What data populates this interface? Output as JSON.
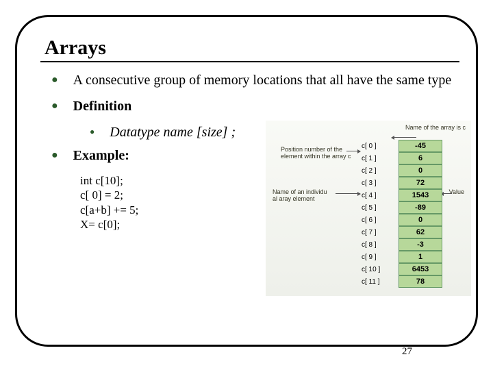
{
  "slide": {
    "title": "Arrays",
    "page_number": "27",
    "bullet_intro": "A consecutive group of memory locations that all have the same type",
    "definition_heading": "Definition",
    "definition_syntax": "Datatype name [size] ;",
    "example_heading": "Example:",
    "example_lines": {
      "l0": "int c[10];",
      "l1": "c[ 0] = 2;",
      "l2": "c[a+b] += 5;",
      "l3": "X= c[0];"
    }
  },
  "figure": {
    "caption_top_right": "Name of the array is c",
    "caption_pos_left_a": "Position number of the",
    "caption_pos_left_b": "element within the array c",
    "caption_elem_left_a": "Name of an individu",
    "caption_elem_left_b": "al aray element",
    "caption_value": "Value",
    "rows": [
      {
        "idx": "c[ 0 ]",
        "val": "-45"
      },
      {
        "idx": "c[ 1 ]",
        "val": "6"
      },
      {
        "idx": "c[ 2 ]",
        "val": "0"
      },
      {
        "idx": "c[ 3 ]",
        "val": "72"
      },
      {
        "idx": "c[ 4 ]",
        "val": "1543"
      },
      {
        "idx": "c[ 5 ]",
        "val": "-89"
      },
      {
        "idx": "c[ 6 ]",
        "val": "0"
      },
      {
        "idx": "c[ 7 ]",
        "val": "62"
      },
      {
        "idx": "c[ 8 ]",
        "val": "-3"
      },
      {
        "idx": "c[ 9 ]",
        "val": "1"
      },
      {
        "idx": "c[ 10 ]",
        "val": "6453"
      },
      {
        "idx": "c[ 11 ]",
        "val": "78"
      }
    ]
  }
}
